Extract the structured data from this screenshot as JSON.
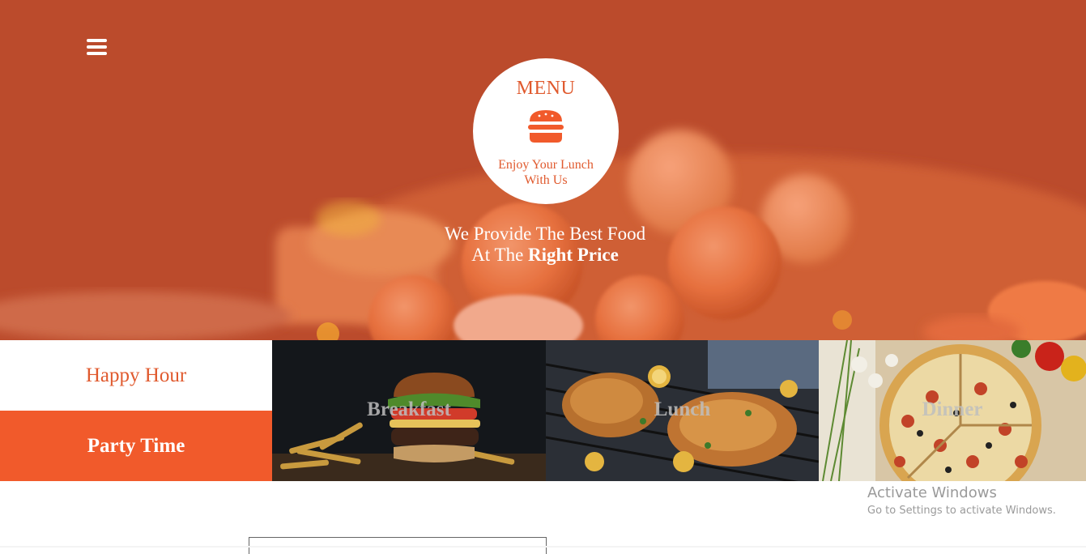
{
  "hero": {
    "menu_icon": "hamburger-menu-icon",
    "logo": {
      "title": "MENU",
      "icon": "burger-icon",
      "tagline": "Enjoy Your Lunch With Us"
    },
    "headline_line1": "We Provide The Best Food",
    "headline_line2_prefix": "At The ",
    "headline_line2_bold": "Right Price"
  },
  "offers": {
    "happy_hour": "Happy Hour",
    "party_time": "Party Time"
  },
  "tiles": {
    "breakfast": "Breakfast",
    "lunch": "Lunch",
    "dinner": "Dinner"
  },
  "watermark": {
    "title": "Activate Windows",
    "subtitle": "Go to Settings to activate Windows."
  },
  "colors": {
    "accent": "#f15a2b",
    "hero_overlay": "#c4522e",
    "white": "#ffffff"
  }
}
